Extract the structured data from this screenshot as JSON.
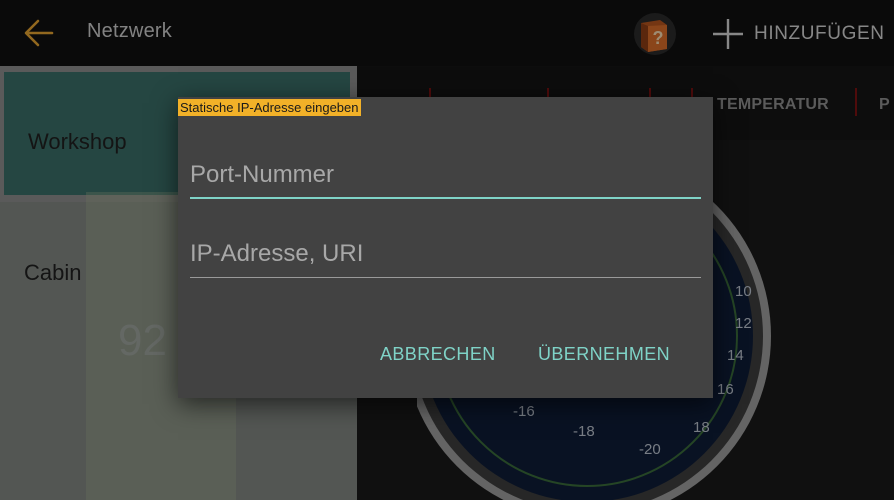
{
  "appbar": {
    "title": "Netzwerk",
    "add_label": "HINZUFÜGEN",
    "back_icon": "arrow-left-icon",
    "help_icon": "help-book-icon",
    "add_icon": "plus-icon"
  },
  "sidebar": {
    "items": [
      {
        "label": "Workshop",
        "selected": true
      },
      {
        "label": "Cabin",
        "selected": false
      }
    ],
    "ghost_value": "92"
  },
  "content": {
    "tabs": [
      "TEMPERATUR",
      "P"
    ],
    "gauge_ticks": [
      "10",
      "12",
      "14",
      "16",
      "18",
      "-20",
      "-18",
      "-16"
    ]
  },
  "dialog": {
    "title": "Statische IP-Adresse eingeben",
    "port_field": {
      "placeholder": "Port-Nummer",
      "value": ""
    },
    "ip_field": {
      "placeholder": "IP-Adresse, URI",
      "value": ""
    },
    "cancel_label": "ABBRECHEN",
    "apply_label": "ÜBERNEHMEN"
  },
  "colors": {
    "accent": "#7fd3c7",
    "title_highlight": "#f2b128",
    "back_arrow": "#e0a030",
    "selected_item": "#3a6c66"
  }
}
